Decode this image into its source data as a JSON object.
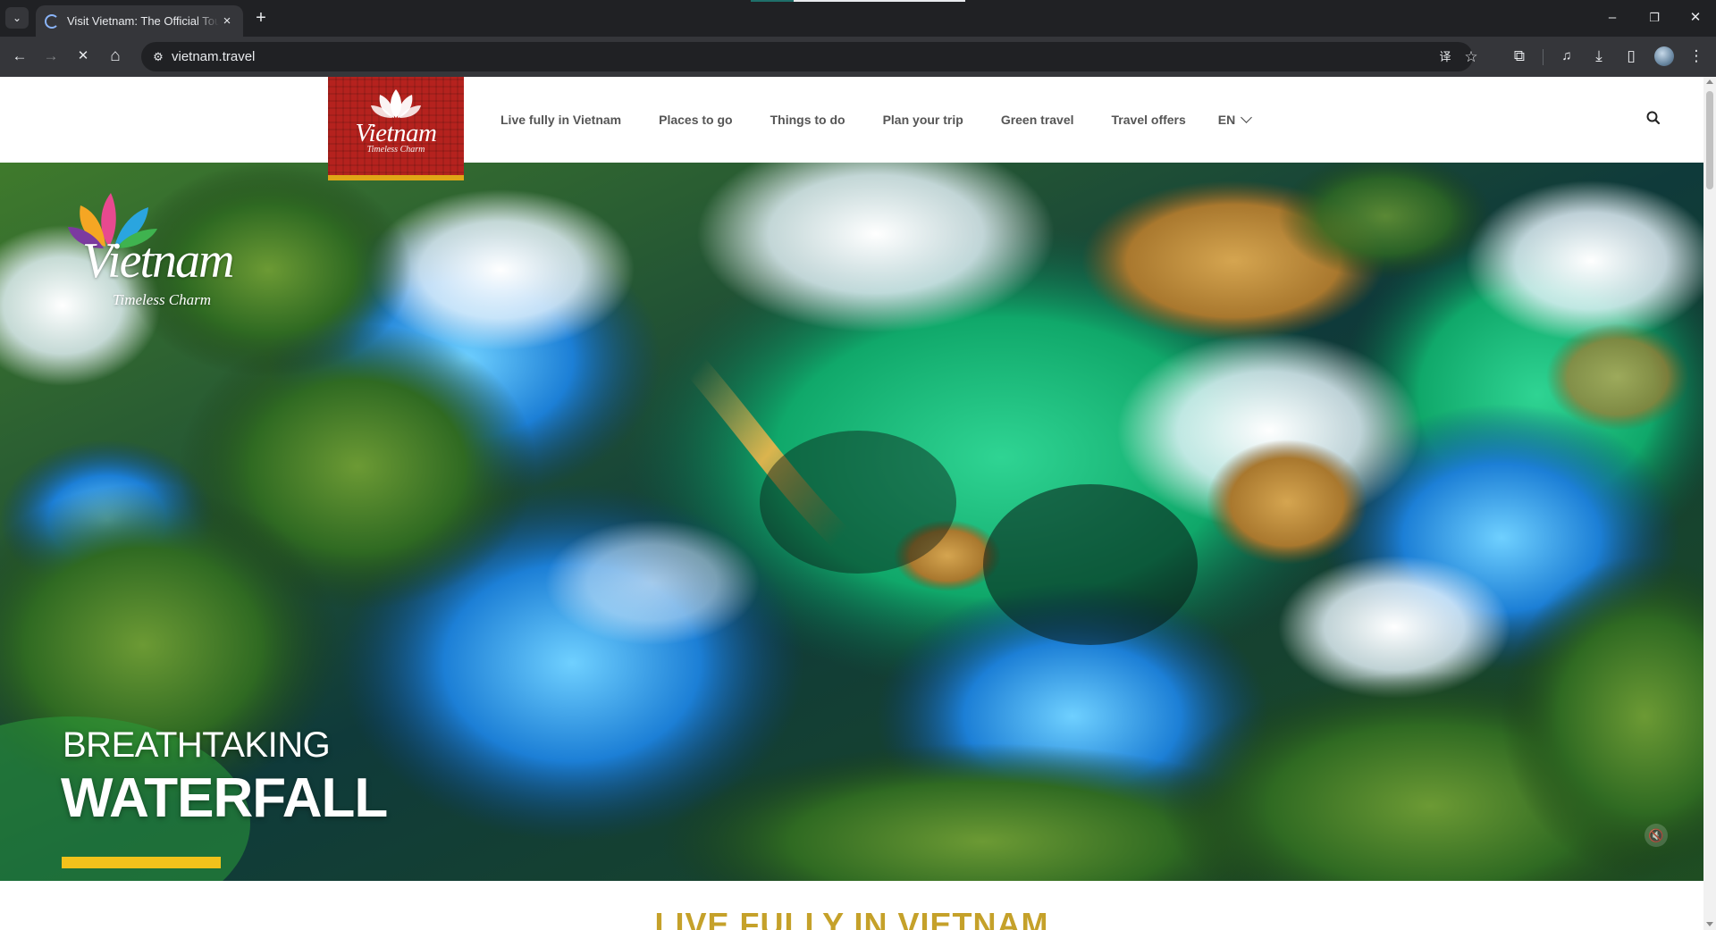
{
  "browser": {
    "tab": {
      "title": "Visit Vietnam: The Official Tourism Website",
      "close_icon": "×"
    },
    "new_tab_icon": "+",
    "window_controls": {
      "minimize": "–",
      "restore": "❐",
      "close": "✕"
    },
    "toolbar": {
      "back": "←",
      "forward": "→",
      "stop": "✕",
      "home": "⌂",
      "site_info": "⚙",
      "url": "vietnam.travel",
      "translate": "译",
      "bookmark": "☆",
      "extensions": "⧉",
      "media": "♫",
      "download": "⤓",
      "side_panel": "▯",
      "menu": "⋮"
    }
  },
  "site": {
    "logo": {
      "word": "Vietnam",
      "tagline": "Timeless Charm"
    },
    "nav": {
      "items": [
        "Live fully in Vietnam",
        "Places to go",
        "Things to do",
        "Plan your trip",
        "Green travel",
        "Travel offers"
      ],
      "language": "EN"
    },
    "hero": {
      "logo_word": "Vietnam",
      "logo_tagline": "Timeless Charm",
      "subtitle": "BREATHTAKING",
      "title": "WATERFALL",
      "accent_color": "#f2c21b",
      "mute_icon": "🔇"
    },
    "section_title": "LIVE FULLY IN VIETNAM"
  },
  "colors": {
    "brand_red": "#b5221e",
    "brand_gold": "#c5a12a",
    "nav_text": "#555555"
  }
}
